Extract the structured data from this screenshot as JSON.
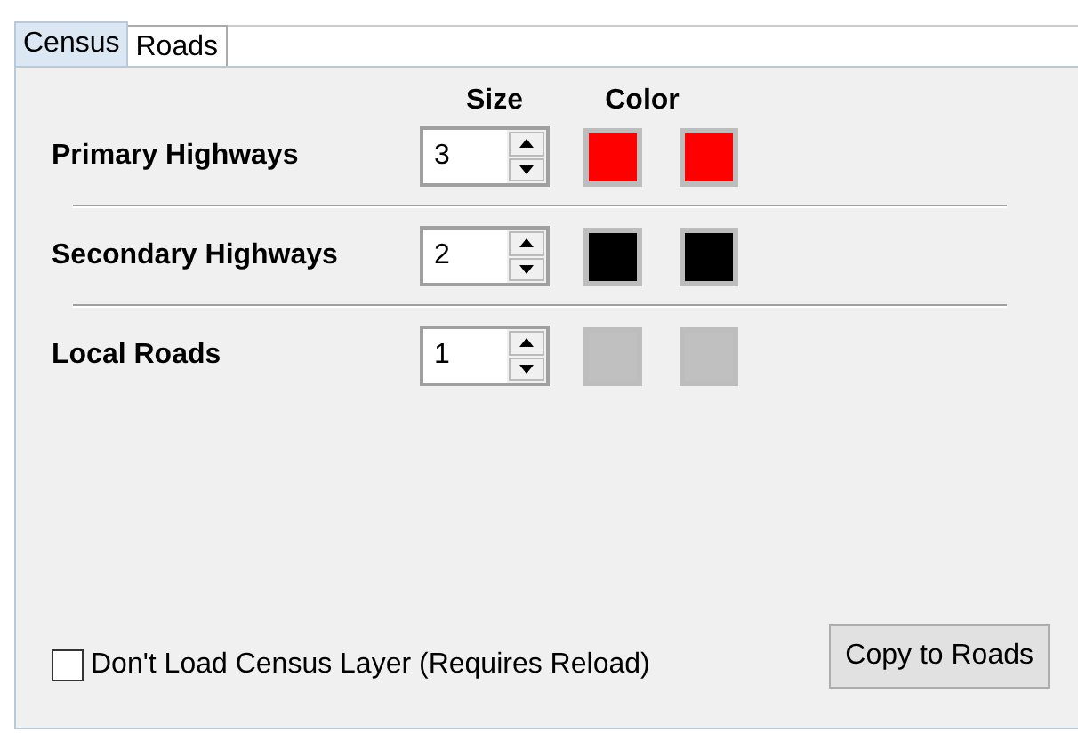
{
  "tabs": [
    {
      "label": "Census",
      "selected": true
    },
    {
      "label": "Roads",
      "selected": false
    }
  ],
  "column_headers": [
    "Size",
    "Color"
  ],
  "rows": [
    {
      "label": "Primary Highways",
      "size": "3",
      "colors": [
        {
          "color": "#ff0000"
        },
        {
          "color": "#ff0000"
        }
      ]
    },
    {
      "label": "Secondary Highways",
      "size": "2",
      "colors": [
        {
          "color": "#000000"
        },
        {
          "color": "#000000"
        }
      ]
    },
    {
      "label": "Local Roads",
      "size": "1",
      "colors": [
        {
          "color": "#c0c0c0"
        },
        {
          "color": "#c0c0c0"
        }
      ]
    }
  ],
  "checkbox": {
    "label": "Don't Load Census Layer (Requires Reload)",
    "checked": false
  },
  "button": "Copy to Roads"
}
